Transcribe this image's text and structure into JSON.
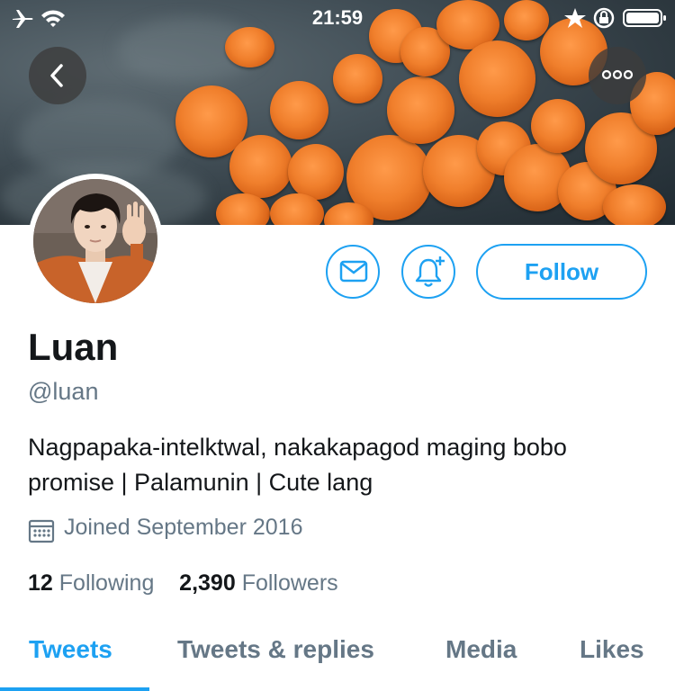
{
  "status_bar": {
    "time": "21:59"
  },
  "profile": {
    "name": "Luan",
    "handle": "@luan",
    "bio": "Nagpapaka-intelktwal, nakakapagod maging bobo promise | Palamunin | Cute lang",
    "joined": "Joined September 2016",
    "following_count": "12",
    "following_label": "Following",
    "followers_count": "2,390",
    "followers_label": "Followers"
  },
  "actions": {
    "follow_label": "Follow"
  },
  "tabs": [
    {
      "label": "Tweets",
      "active": true
    },
    {
      "label": "Tweets & replies"
    },
    {
      "label": "Media"
    },
    {
      "label": "Likes"
    }
  ],
  "colors": {
    "accent": "#1da1f2",
    "muted": "#657786",
    "text": "#14171a"
  },
  "icons": [
    "airplane-icon",
    "wifi-icon",
    "star-icon",
    "orientation-lock-icon",
    "battery-icon",
    "back-arrow-icon",
    "more-icon",
    "mail-icon",
    "bell-plus-icon",
    "calendar-icon"
  ]
}
